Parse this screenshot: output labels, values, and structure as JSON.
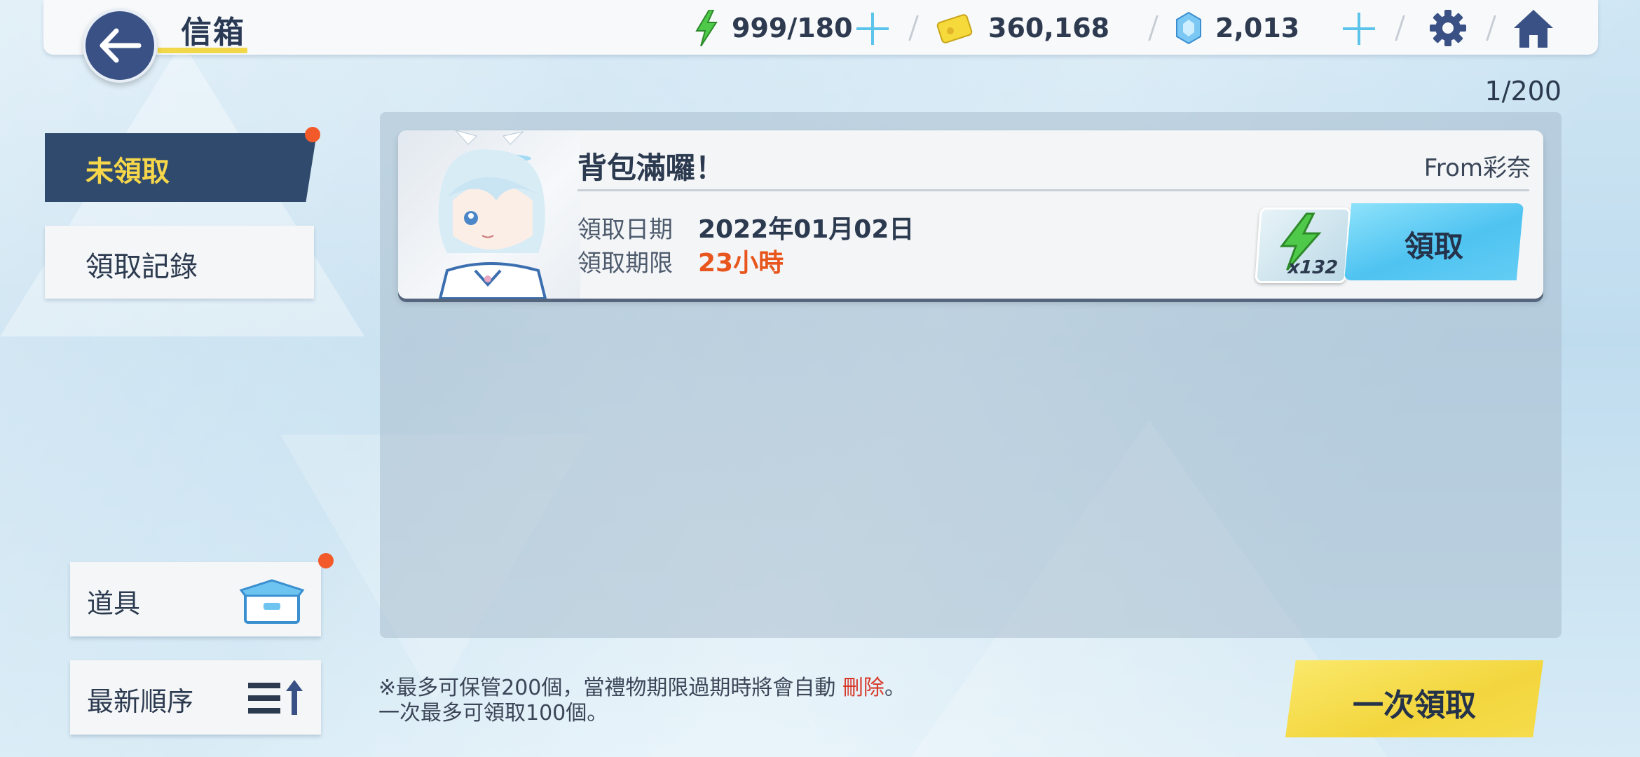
{
  "header": {
    "title": "信箱",
    "back_icon": "arrow-left-icon",
    "stamina": "999/180",
    "credits": "360,168",
    "gems": "2,013",
    "settings_icon": "gear-icon",
    "home_icon": "home-icon"
  },
  "tabs": [
    {
      "label": "未領取",
      "active": true,
      "badge": true
    },
    {
      "label": "領取記錄",
      "active": false,
      "badge": false
    }
  ],
  "side": {
    "items_label": "道具",
    "sort_label": "最新順序"
  },
  "mail_count": "1/200",
  "mails": [
    {
      "title": "背包滿囉！",
      "from": "From彩奈",
      "date_label": "領取日期",
      "date_value": "2022年01月02日",
      "limit_label": "領取期限",
      "limit_value": "23小時",
      "reward_qty": "x132",
      "claim_label": "領取"
    }
  ],
  "footer": {
    "note_prefix": "※最多可保管200個，當禮物期限過期時將會自動 ",
    "note_delete": "刪除",
    "note_suffix": "。",
    "note_line2": "一次最多可領取100個。",
    "claim_all_label": "一次領取"
  },
  "colors": {
    "accent_yellow": "#f3d63e",
    "accent_blue": "#4fc3f1",
    "navy": "#2f4a6d",
    "alert_red": "#e8561e"
  }
}
